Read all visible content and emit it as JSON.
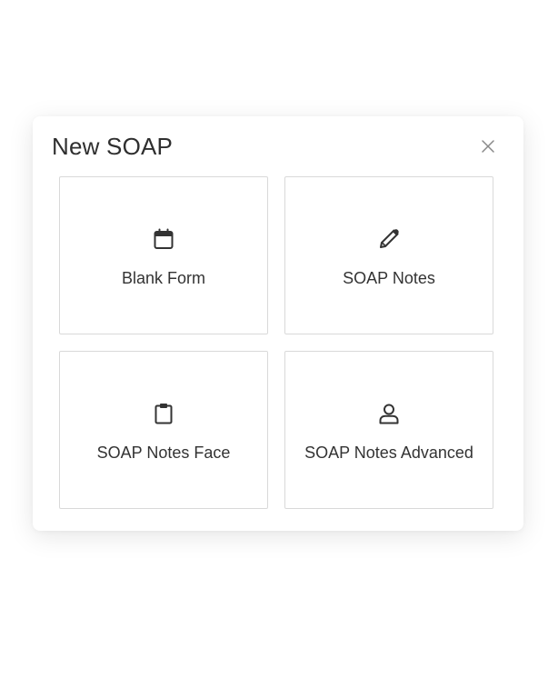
{
  "dialog": {
    "title": "New SOAP",
    "close_icon": "close-icon"
  },
  "options": [
    {
      "label": "Blank Form",
      "icon": "calendar-icon"
    },
    {
      "label": "SOAP Notes",
      "icon": "pen-icon"
    },
    {
      "label": "SOAP Notes Face",
      "icon": "clipboard-icon"
    },
    {
      "label": "SOAP Notes Advanced",
      "icon": "user-icon"
    }
  ],
  "colors": {
    "text": "#333333",
    "title": "#2f2f2f",
    "border": "#d9d9d9",
    "icon": "#333333",
    "close": "#888888"
  }
}
